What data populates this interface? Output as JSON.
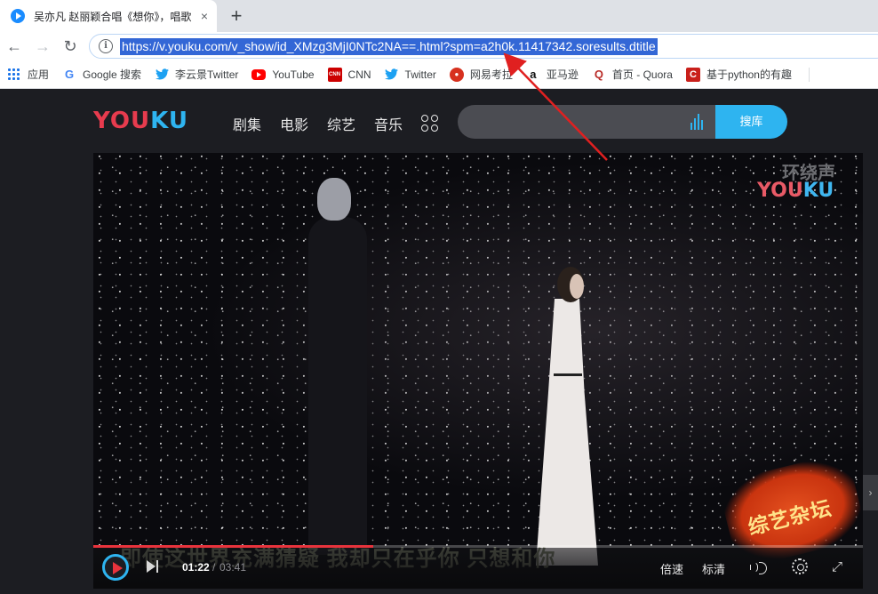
{
  "browser": {
    "tab_title": "吴亦凡 赵丽颖合唱《想你》，唱歌",
    "tab_close": "×",
    "new_tab": "+",
    "url": "https://v.youku.com/v_show/id_XMzg3MjI0NTc2NA==.html?spm=a2h0k.11417342.soresults.dtitle",
    "back": "←",
    "forward": "→",
    "reload": "↻",
    "info": "i"
  },
  "bookmarks": [
    {
      "label": "应用",
      "icon": "apps-grid-icon"
    },
    {
      "label": "Google 搜索",
      "icon": "google-icon",
      "glyph": "G"
    },
    {
      "label": "李云景Twitter",
      "icon": "twitter-icon",
      "glyph": "🐦"
    },
    {
      "label": "YouTube",
      "icon": "youtube-icon"
    },
    {
      "label": "CNN",
      "icon": "cnn-icon",
      "glyph": "CNN"
    },
    {
      "label": "Twitter",
      "icon": "twitter-icon",
      "glyph": "🐦"
    },
    {
      "label": "网易考拉",
      "icon": "kaola-icon",
      "glyph": "●"
    },
    {
      "label": "亚马逊",
      "icon": "amazon-icon",
      "glyph": "a"
    },
    {
      "label": "首页 - Quora",
      "icon": "quora-icon",
      "glyph": "Q"
    },
    {
      "label": "基于python的有趣",
      "icon": "csdn-icon",
      "glyph": "C"
    }
  ],
  "youku": {
    "logo_part1": "YOU",
    "logo_part2": "KU",
    "nav": [
      "剧集",
      "电影",
      "综艺",
      "音乐"
    ],
    "search_placeholder": "",
    "search_button": "搜库"
  },
  "player": {
    "watermark_top": "环绕声",
    "watermark_logo_1": "YOU",
    "watermark_logo_2": "KU",
    "stamp_text": "综艺杂坛",
    "subtitle": "即使这世界充满猜疑 我却只在乎你 只想和你",
    "time_current": "01:22",
    "time_separator": "/",
    "time_total": "03:41",
    "progress": 0.364,
    "speed_label": "倍速",
    "quality_label": "标清"
  },
  "colors": {
    "youku_red": "#e73b4e",
    "youku_blue": "#2eb4f0",
    "progress_red": "#e8333c",
    "url_highlight": "#3367d6",
    "annotation_arrow": "#e02020"
  }
}
